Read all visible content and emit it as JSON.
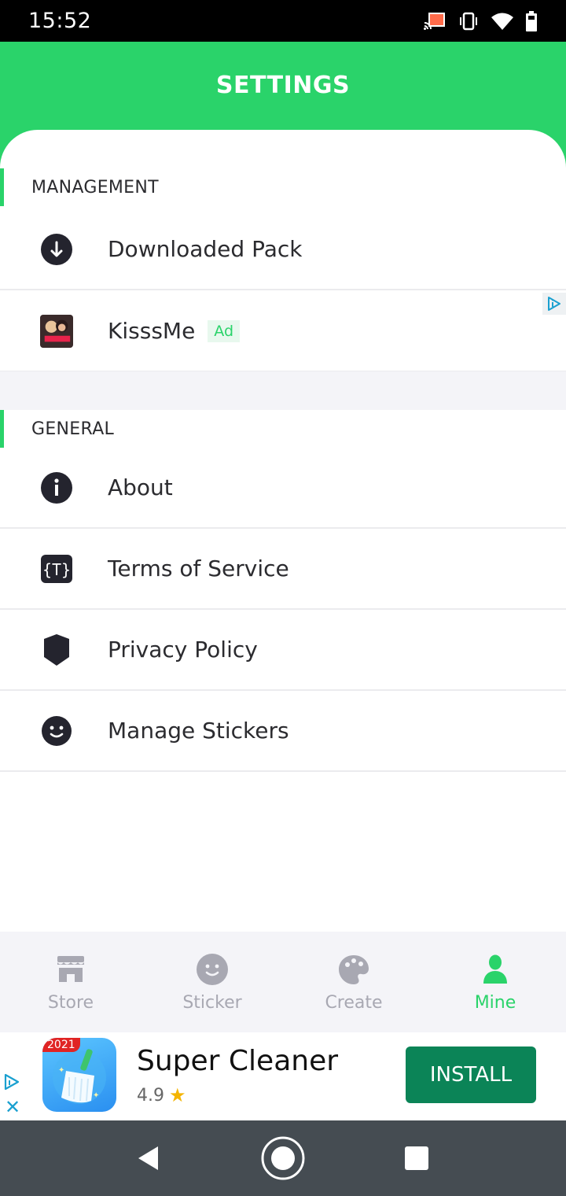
{
  "status_bar": {
    "time": "15:52",
    "icons": [
      "cast-icon",
      "vibrate-icon",
      "wifi-icon",
      "battery-icon"
    ]
  },
  "header": {
    "title": "SETTINGS"
  },
  "colors": {
    "accent": "#2ad36a",
    "text": "#2b2b2f",
    "inactive": "#a8a8b2",
    "install": "#0b8457"
  },
  "sections": {
    "management": {
      "label": "MANAGEMENT",
      "items": [
        {
          "label": "Downloaded Pack",
          "icon": "download-icon"
        },
        {
          "label": "KisssMe",
          "icon": "app-thumbnail",
          "ad_tag": "Ad"
        }
      ]
    },
    "general": {
      "label": "GENERAL",
      "items": [
        {
          "label": "About",
          "icon": "info-icon"
        },
        {
          "label": "Terms of Service",
          "icon": "terms-icon"
        },
        {
          "label": "Privacy Policy",
          "icon": "shield-icon"
        },
        {
          "label": "Manage Stickers",
          "icon": "smiley-icon"
        }
      ]
    }
  },
  "bottom_nav": {
    "items": [
      {
        "label": "Store",
        "icon": "store-icon",
        "active": false
      },
      {
        "label": "Sticker",
        "icon": "sticker-icon",
        "active": false
      },
      {
        "label": "Create",
        "icon": "palette-icon",
        "active": false
      },
      {
        "label": "Mine",
        "icon": "person-icon",
        "active": true
      }
    ]
  },
  "banner_ad": {
    "badge": "2021",
    "title": "Super Cleaner",
    "rating": "4.9",
    "rating_icon": "★",
    "close": "✕",
    "cta": "INSTALL"
  },
  "system_nav": {
    "buttons": [
      "back-icon",
      "home-icon",
      "recents-icon"
    ]
  }
}
